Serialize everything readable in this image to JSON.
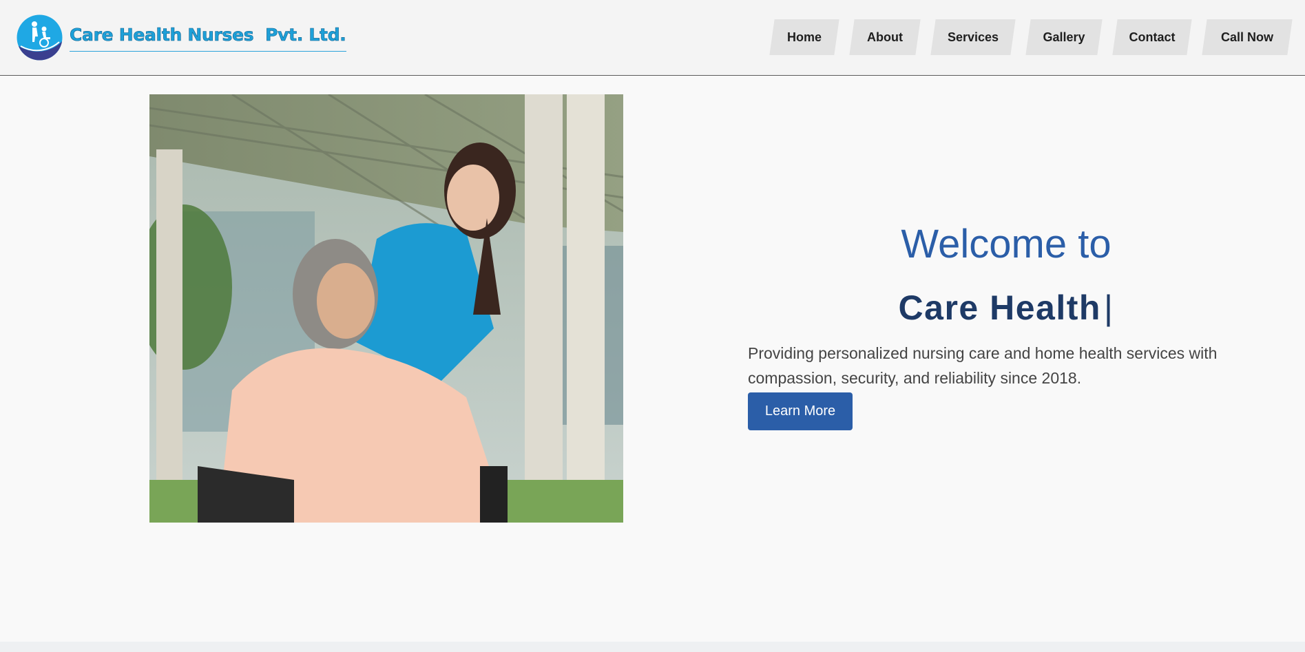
{
  "header": {
    "brand_name": "Care Health Nurses  Pvt. Ltd.",
    "logo_icon": "wheelchair-caregiver-icon",
    "nav": [
      {
        "label": "Home"
      },
      {
        "label": "About"
      },
      {
        "label": "Services"
      },
      {
        "label": "Gallery"
      },
      {
        "label": "Contact"
      },
      {
        "label": "Call Now"
      }
    ]
  },
  "hero": {
    "welcome_line": "Welcome to",
    "brand_line": "Care Health",
    "cursor": "|",
    "description": "Providing personalized nursing care and home health services with compassion, security, and reliability since 2018.",
    "cta_label": "Learn More",
    "image_icon": "nurse-and-patient-photo"
  },
  "colors": {
    "primary": "#2b5ea8",
    "heading_dark": "#1e3a66",
    "brand_cyan": "#1ea0d8",
    "nav_bg": "#e2e2e2",
    "page_bg": "#f9f9f9"
  }
}
